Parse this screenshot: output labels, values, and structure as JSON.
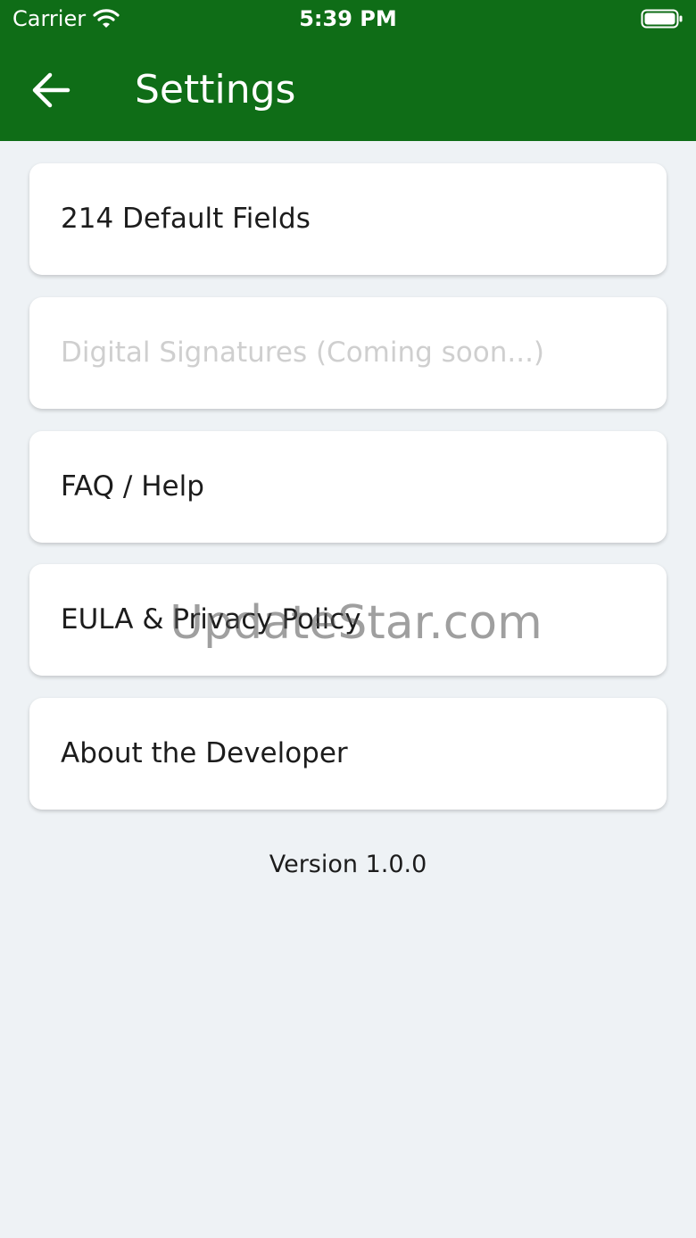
{
  "status_bar": {
    "carrier": "Carrier",
    "time": "5:39 PM",
    "wifi_icon": "wifi-icon",
    "battery_icon": "battery-icon"
  },
  "header": {
    "back_icon": "arrow-left-icon",
    "title": "Settings",
    "color": "#0f6d17"
  },
  "menu": {
    "items": [
      {
        "label": "214 Default Fields",
        "enabled": true
      },
      {
        "label": "Digital Signatures (Coming soon...)",
        "enabled": false
      },
      {
        "label": "FAQ / Help",
        "enabled": true
      },
      {
        "label": "EULA & Privacy Policy",
        "enabled": true
      },
      {
        "label": "About the Developer",
        "enabled": true
      }
    ]
  },
  "version": "Version 1.0.0",
  "watermark": "UpdateStar.com"
}
